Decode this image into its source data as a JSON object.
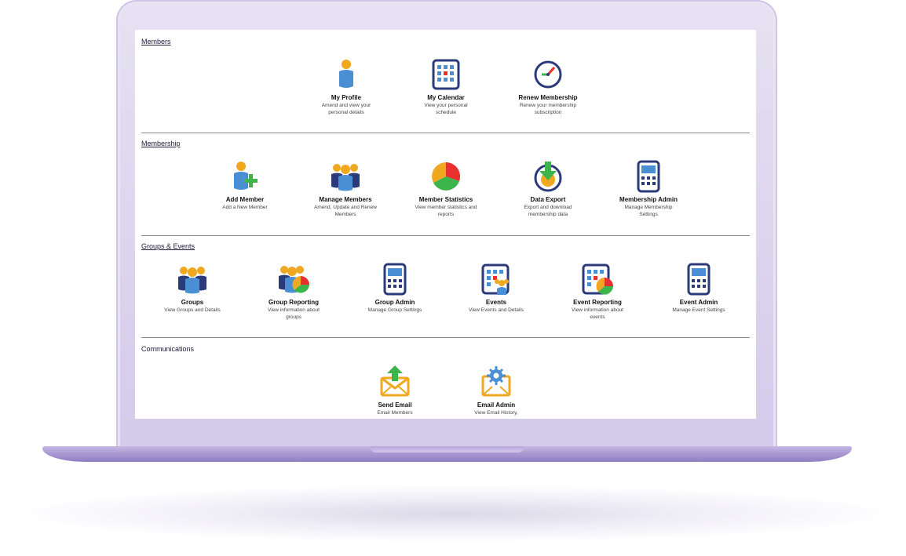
{
  "sections": [
    {
      "title": "Members",
      "tiles": [
        {
          "title": "My Profile",
          "desc": "Amend and view your personal details",
          "icon": "person-icon"
        },
        {
          "title": "My Calendar",
          "desc": "View your personal schedule",
          "icon": "calendar-icon"
        },
        {
          "title": "Renew Membership",
          "desc": "Renew your membership subscription",
          "icon": "clock-icon"
        }
      ]
    },
    {
      "title": "Membership",
      "tiles": [
        {
          "title": "Add Member",
          "desc": "Add a New Member",
          "icon": "add-person-icon"
        },
        {
          "title": "Manage Members",
          "desc": "Amend, Update and Renew Members",
          "icon": "people-icon"
        },
        {
          "title": "Member Statistics",
          "desc": "View member statistics and reports",
          "icon": "pie-chart-icon"
        },
        {
          "title": "Data Export",
          "desc": "Export and download membership data",
          "icon": "download-icon"
        },
        {
          "title": "Membership Admin",
          "desc": "Manage Membership Settings",
          "icon": "calculator-icon"
        }
      ]
    },
    {
      "title": "Groups & Events",
      "tiles": [
        {
          "title": "Groups",
          "desc": "View Groups and Details",
          "icon": "people-icon"
        },
        {
          "title": "Group Reporting",
          "desc": "View information about groups",
          "icon": "people-chart-icon"
        },
        {
          "title": "Group Admin",
          "desc": "Manage Group Settings",
          "icon": "calculator-icon"
        },
        {
          "title": "Events",
          "desc": "View Events and Details",
          "icon": "calendar-people-icon"
        },
        {
          "title": "Event Reporting",
          "desc": "View information about events",
          "icon": "calendar-chart-icon"
        },
        {
          "title": "Event Admin",
          "desc": "Manage Event Settings",
          "icon": "calculator-icon"
        }
      ]
    },
    {
      "title": "Communications",
      "tiles": [
        {
          "title": "Send Email",
          "desc": "Email Members",
          "icon": "send-email-icon"
        },
        {
          "title": "Email Admin",
          "desc": "View Email History,",
          "icon": "email-settings-icon"
        }
      ]
    }
  ],
  "colors": {
    "navy": "#2b3a7a",
    "blue": "#4a8fd4",
    "orange": "#f0a820",
    "green": "#3cb54a",
    "red": "#e8312f",
    "laptop": "#d9d0ee"
  }
}
